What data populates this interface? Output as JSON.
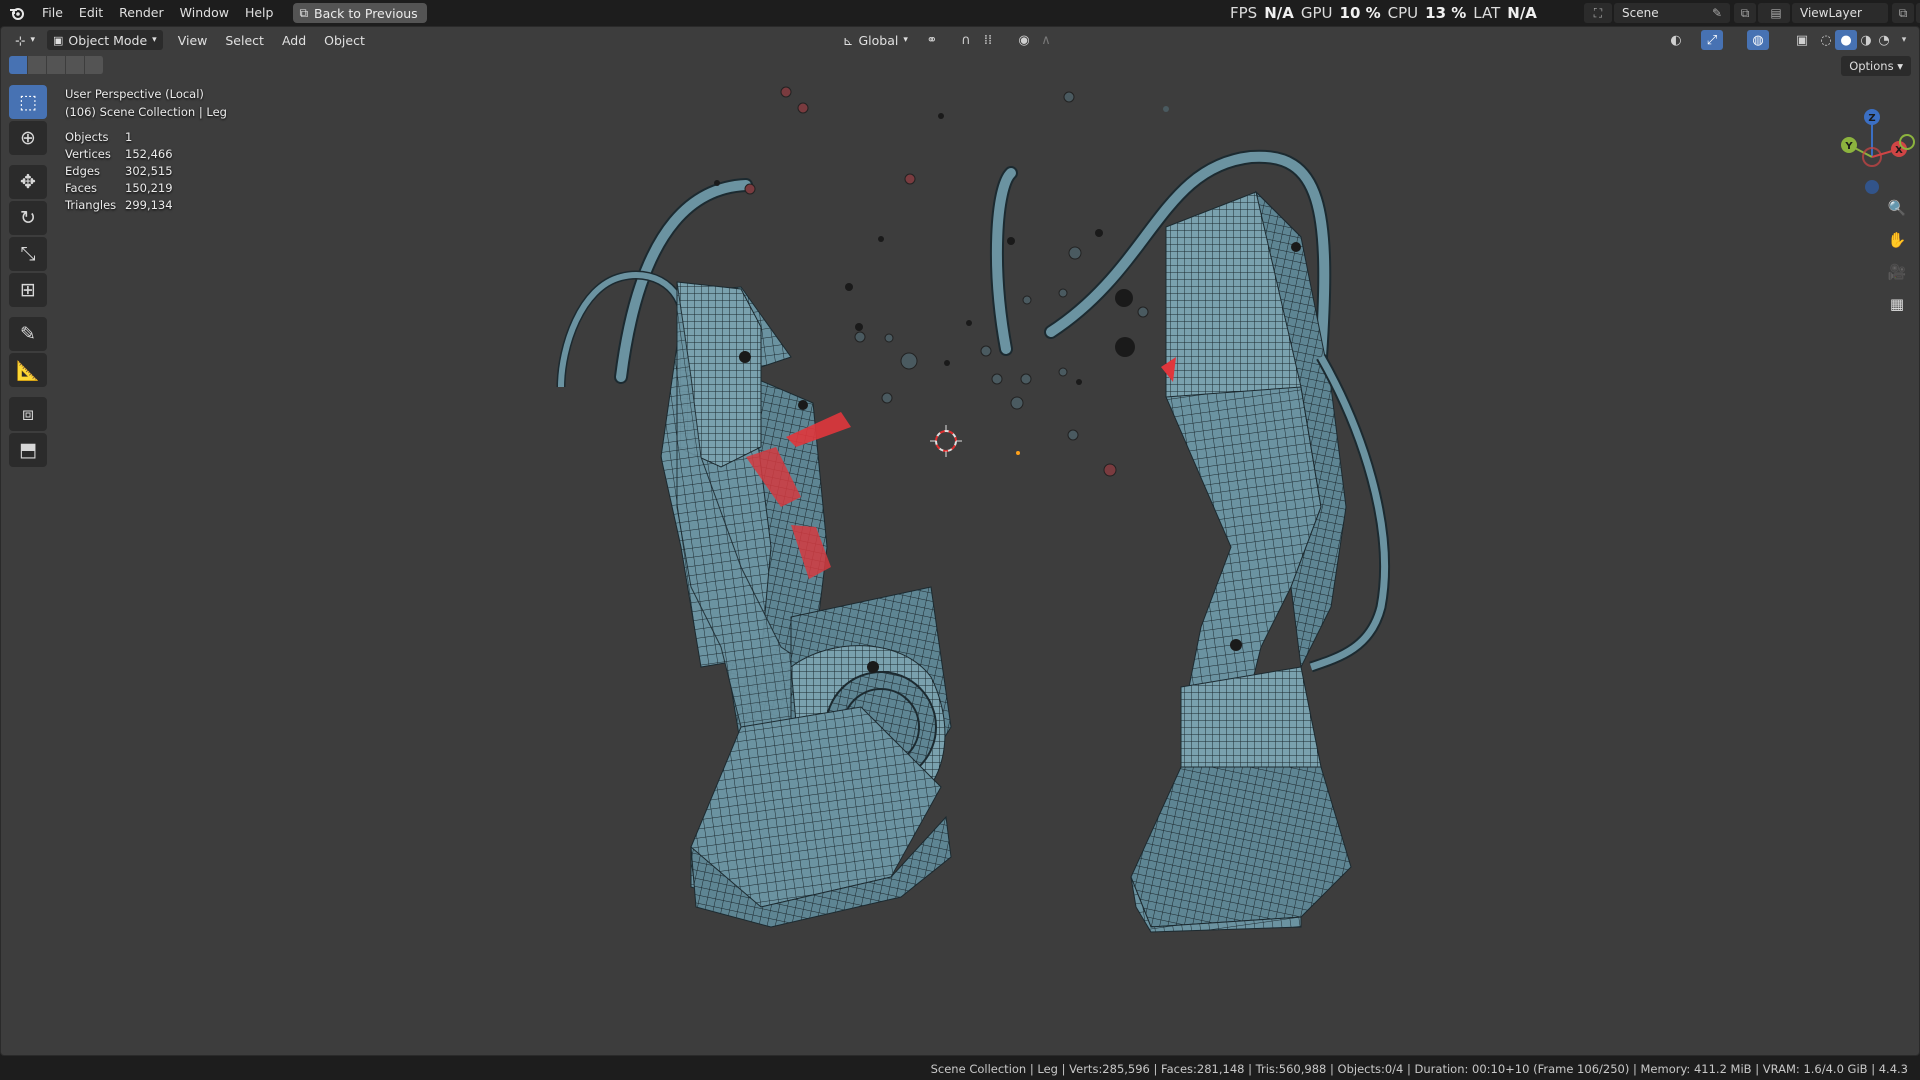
{
  "topbar": {
    "menus": [
      "File",
      "Edit",
      "Render",
      "Window",
      "Help"
    ],
    "back_button": "Back to Previous",
    "perf": {
      "fps_label": "FPS",
      "fps_value": "N/A",
      "gpu_label": "GPU",
      "gpu_value": "10 %",
      "cpu_label": "CPU",
      "cpu_value": "13 %",
      "lat_label": "LAT",
      "lat_value": "N/A"
    },
    "scene_name": "Scene",
    "view_layer": "ViewLayer"
  },
  "viewport_header": {
    "mode": "Object Mode",
    "menus": [
      "View",
      "Select",
      "Add",
      "Object"
    ],
    "transform_orientation": "Global",
    "options_label": "Options"
  },
  "overlay": {
    "view_name": "User Perspective (Local)",
    "collection_line": "(106) Scene Collection | Leg",
    "stats": [
      {
        "label": "Objects",
        "value": "1"
      },
      {
        "label": "Vertices",
        "value": "152,466"
      },
      {
        "label": "Edges",
        "value": "302,515"
      },
      {
        "label": "Faces",
        "value": "150,219"
      },
      {
        "label": "Triangles",
        "value": "299,134"
      }
    ]
  },
  "gizmo": {
    "z": "Z",
    "y": "Y",
    "x": "X"
  },
  "statusbar": {
    "text": "Scene Collection | Leg | Verts:285,596 | Faces:281,148 | Tris:560,988 | Objects:0/4 | Duration: 00:10+10 (Frame 106/250) | Memory: 411.2 MiB | VRAM: 1.6/4.0 GiB | 4.4.3"
  },
  "colors": {
    "mesh": "#6b93a1",
    "wire": "#1c2a30",
    "accent": "#4772b3",
    "highlight": "#e0363c"
  }
}
